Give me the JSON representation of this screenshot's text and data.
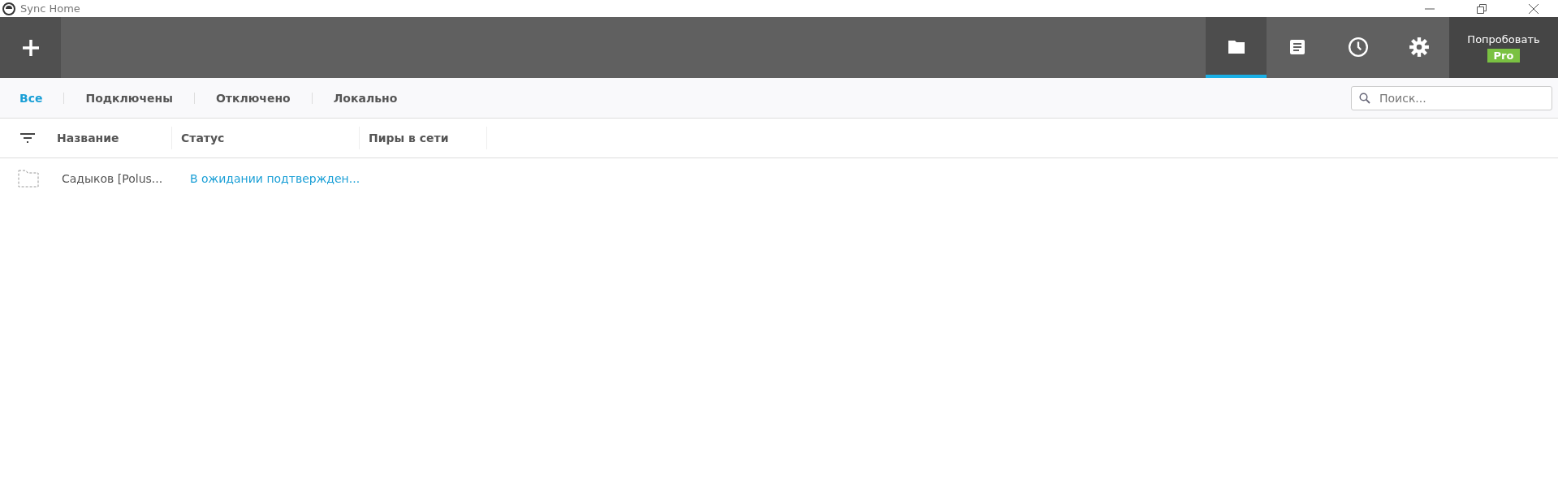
{
  "window": {
    "title": "Sync Home"
  },
  "toolbar": {
    "nav": [
      {
        "kind": "folder",
        "selected": true
      },
      {
        "kind": "log",
        "selected": false
      },
      {
        "kind": "history",
        "selected": false
      },
      {
        "kind": "settings",
        "selected": false
      }
    ],
    "promo": {
      "label": "Попробовать",
      "badge": "Pro"
    }
  },
  "filters": [
    {
      "label": "Все",
      "selected": true
    },
    {
      "label": "Подключены",
      "selected": false
    },
    {
      "label": "Отключено",
      "selected": false
    },
    {
      "label": "Локально",
      "selected": false
    }
  ],
  "search": {
    "placeholder": "Поиск..."
  },
  "table": {
    "columns": [
      "Название",
      "Статус",
      "Пиры в сети"
    ],
    "rows": [
      {
        "name": "Садыков [Polus...",
        "status": "В ожидании подтвержден..."
      }
    ]
  }
}
